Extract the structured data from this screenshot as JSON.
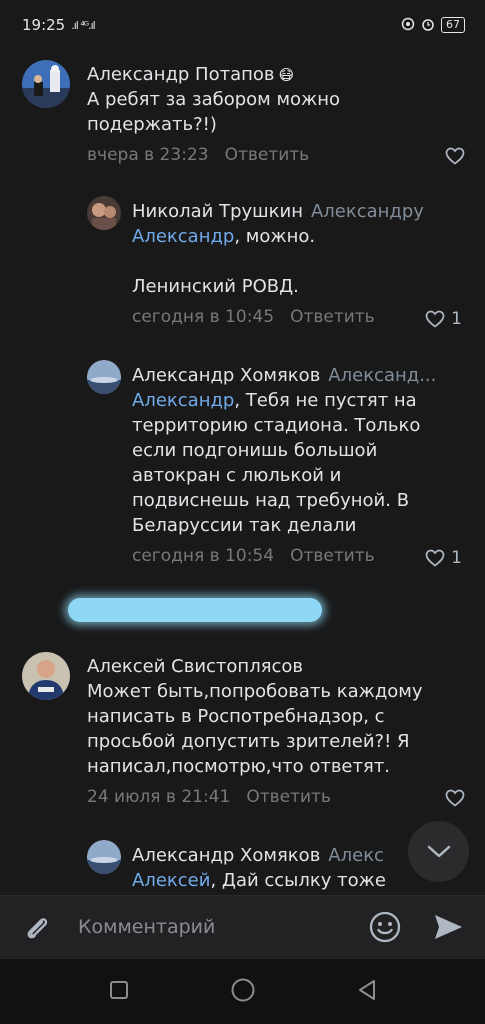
{
  "status": {
    "time": "19:25",
    "signal": ".ıl ⁴ᴳ.ıl",
    "battery": "67"
  },
  "comments": [
    {
      "author": "Александр Потапов",
      "emoji": "😷",
      "text": "А ребят за забором можно подержать?!)",
      "time": "вчера в 23:23",
      "reply_label": "Ответить"
    },
    {
      "author": "Николай Трушкин",
      "reply_to": "Александру",
      "mention": "Александр",
      "text": ", можно.",
      "text2": "Ленинский РОВД.",
      "time": "сегодня в 10:45",
      "reply_label": "Ответить",
      "likes": "1"
    },
    {
      "author": "Александр Хомяков",
      "reply_to": "Александ...",
      "mention": "Александр",
      "text": ", Тебя не пустят на территорию стадиона. Только если подгонишь большой автокран с люлькой и подвиснешь над требуной. В Беларуссии так делали",
      "time": "сегодня в 10:54",
      "reply_label": "Ответить",
      "likes": "1"
    },
    {
      "author": "Алексей Свистоплясов",
      "text": "Может быть,попробовать каждому написать в Роспотребнадзор, с просьбой допустить зрителей?! Я написал,посмотрю,что ответят.",
      "time": "24 июля в 21:41",
      "reply_label": "Ответить"
    },
    {
      "author": "Александр Хомяков",
      "reply_to": "Алекс",
      "mention": "Алексей",
      "text": ", Дай ссылку тоже напишу."
    }
  ],
  "composer": {
    "placeholder": "Комментарий"
  },
  "colors": {
    "background": "#19191a",
    "link": "#71aaeb",
    "secondary": "#76787a"
  }
}
